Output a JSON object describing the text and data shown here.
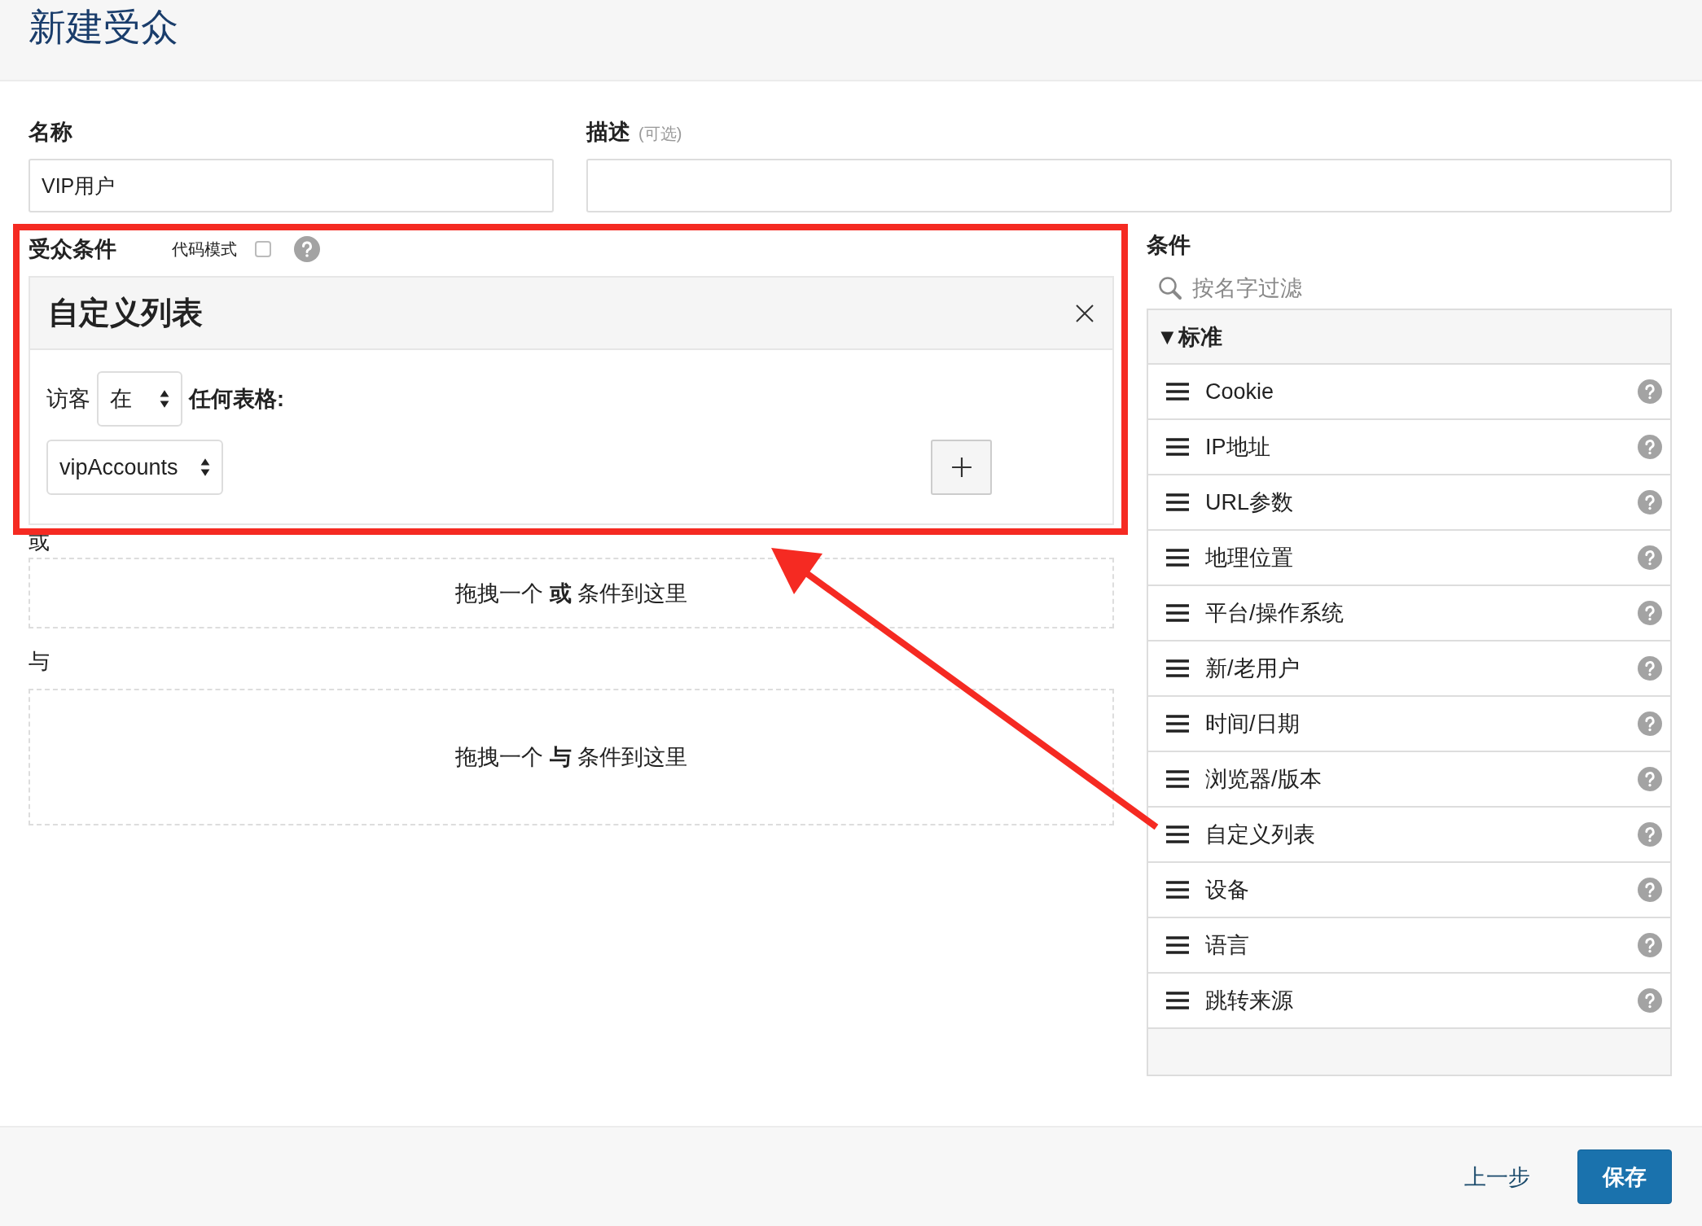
{
  "page": {
    "title": "新建受众"
  },
  "name_field": {
    "label": "名称",
    "value": "VIP用户"
  },
  "description_field": {
    "label": "描述",
    "hint": "(可选)"
  },
  "audience_conditions": {
    "label": "受众条件",
    "code_mode": {
      "label": "代码模式",
      "checked": false
    },
    "condition_card": {
      "title": "自定义列表",
      "prefix": "访客",
      "operator": "在",
      "suffix": "任何表格:",
      "list_select": "vipAccounts"
    },
    "or_label": "或",
    "or_drop": "拖拽一个 **或** 条件到这里",
    "and_label": "与",
    "and_drop": "拖拽一个 **与** 条件到这里"
  },
  "conditions_panel": {
    "title": "条件",
    "search": {
      "placeholder": "按名字过滤"
    },
    "group": "▼标准",
    "items": [
      "Cookie",
      "IP地址",
      "URL参数",
      "地理位置",
      "平台/操作系统",
      "新/老用户",
      "时间/日期",
      "浏览器/版本",
      "自定义列表",
      "设备",
      "语言",
      "跳转来源"
    ]
  },
  "footer": {
    "back": "上一步",
    "save": "保存"
  }
}
